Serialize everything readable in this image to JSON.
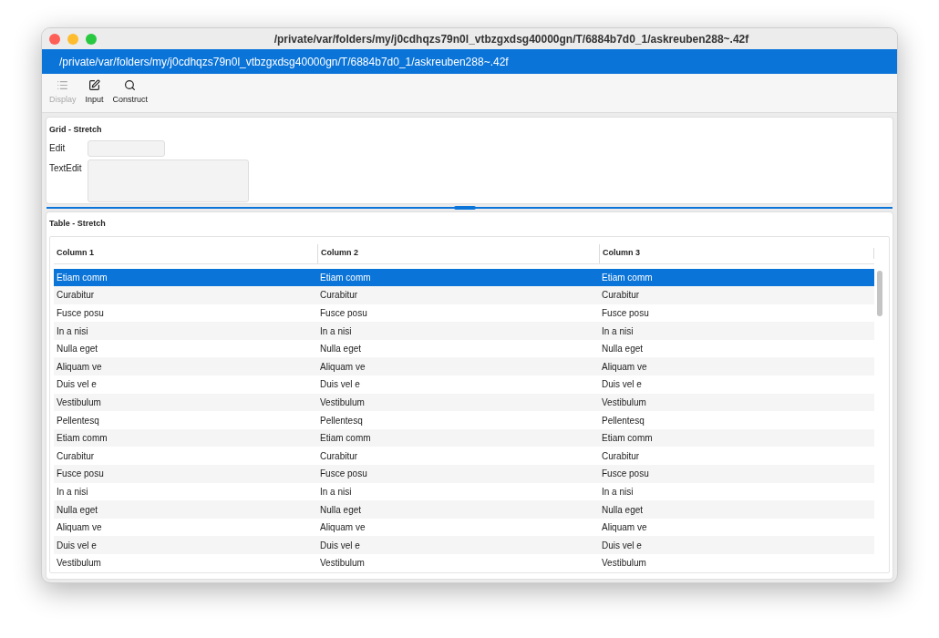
{
  "window": {
    "title": "/private/var/folders/my/j0cdhqzs79n0l_vtbzgxdsg40000gn/T/6884b7d0_1/askreuben288~.42f"
  },
  "path_bar": {
    "text": "/private/var/folders/my/j0cdhqzs79n0l_vtbzgxdsg40000gn/T/6884b7d0_1/askreuben288~.42f"
  },
  "toolbar": [
    {
      "kind": "list",
      "label": "Display",
      "disabled": true
    },
    {
      "kind": "edit",
      "label": "Input",
      "disabled": false
    },
    {
      "kind": "search",
      "label": "Construct",
      "disabled": false
    }
  ],
  "grid": {
    "title": "Grid - Stretch",
    "edit_label": "Edit",
    "textedit_label": "TextEdit"
  },
  "table": {
    "title": "Table - Stretch",
    "columns": [
      "Column 1",
      "Column 2",
      "Column 3"
    ],
    "rows": [
      {
        "cells": [
          "Etiam comm",
          "Etiam comm",
          "Etiam comm"
        ],
        "selected": true
      },
      {
        "cells": [
          "Curabitur",
          "Curabitur",
          "Curabitur"
        ],
        "selected": false
      },
      {
        "cells": [
          "Fusce posu",
          "Fusce posu",
          "Fusce posu"
        ],
        "selected": false
      },
      {
        "cells": [
          "In a nisi",
          "In a nisi",
          "In a nisi"
        ],
        "selected": false
      },
      {
        "cells": [
          "Nulla eget",
          "Nulla eget",
          "Nulla eget"
        ],
        "selected": false
      },
      {
        "cells": [
          "Aliquam ve",
          "Aliquam ve",
          "Aliquam ve"
        ],
        "selected": false
      },
      {
        "cells": [
          "Duis vel e",
          "Duis vel e",
          "Duis vel e"
        ],
        "selected": false
      },
      {
        "cells": [
          "Vestibulum",
          "Vestibulum",
          "Vestibulum"
        ],
        "selected": false
      },
      {
        "cells": [
          "Pellentesq",
          "Pellentesq",
          "Pellentesq"
        ],
        "selected": false
      },
      {
        "cells": [
          "Etiam comm",
          "Etiam comm",
          "Etiam comm"
        ],
        "selected": false
      },
      {
        "cells": [
          "Curabitur",
          "Curabitur",
          "Curabitur"
        ],
        "selected": false
      },
      {
        "cells": [
          "Fusce posu",
          "Fusce posu",
          "Fusce posu"
        ],
        "selected": false
      },
      {
        "cells": [
          "In a nisi",
          "In a nisi",
          "In a nisi"
        ],
        "selected": false
      },
      {
        "cells": [
          "Nulla eget",
          "Nulla eget",
          "Nulla eget"
        ],
        "selected": false
      },
      {
        "cells": [
          "Aliquam ve",
          "Aliquam ve",
          "Aliquam ve"
        ],
        "selected": false
      },
      {
        "cells": [
          "Duis vel e",
          "Duis vel e",
          "Duis vel e"
        ],
        "selected": false
      },
      {
        "cells": [
          "Vestibulum",
          "Vestibulum",
          "Vestibulum"
        ],
        "selected": false
      }
    ]
  }
}
